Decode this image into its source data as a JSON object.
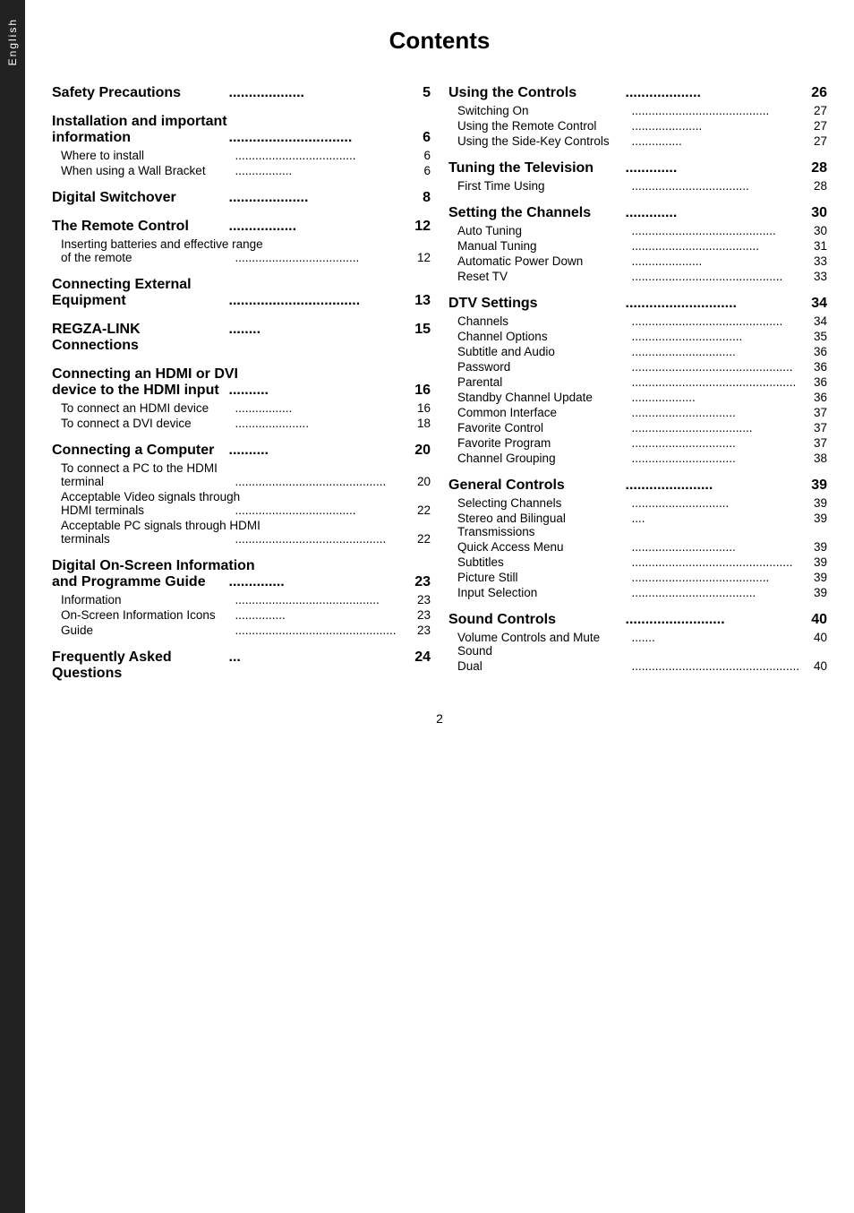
{
  "page": {
    "title": "Contents",
    "page_number": "2",
    "tab_label": "English"
  },
  "left_column": [
    {
      "type": "heading",
      "text": "Safety Precautions ",
      "dots": "...................",
      "page": "5"
    },
    {
      "type": "heading_multiline",
      "line1": "Installation and important",
      "line2": "information",
      "dots": "...............................",
      "page": "6"
    },
    {
      "type": "sub",
      "text": "Where to install",
      "dots": "....................................",
      "page": "6"
    },
    {
      "type": "sub",
      "text": "When using a Wall Bracket ",
      "dots": ".................",
      "page": "6"
    },
    {
      "type": "heading",
      "text": "Digital Switchover ",
      "dots": "....................",
      "page": "8"
    },
    {
      "type": "heading",
      "text": "The Remote Control ",
      "dots": ".................",
      "page": "12"
    },
    {
      "type": "sub_multiline",
      "line1": "Inserting batteries and effective range",
      "line2": "of the remote ",
      "dots": ".....................................",
      "page": "12"
    },
    {
      "type": "heading_multiline",
      "line1": "Connecting External",
      "line2": "Equipment",
      "dots": ".................................",
      "page": "13"
    },
    {
      "type": "heading",
      "text": "REGZA-LINK Connections",
      "dots": "........",
      "page": "15"
    },
    {
      "type": "heading_multiline",
      "line1": "Connecting an HDMI or DVI",
      "line2": "device to the HDMI input",
      "dots": "..........",
      "page": "16"
    },
    {
      "type": "sub",
      "text": "To connect an HDMI device ",
      "dots": ".................",
      "page": "16"
    },
    {
      "type": "sub",
      "text": "To connect a DVI device",
      "dots": "......................",
      "page": "18"
    },
    {
      "type": "heading",
      "text": "Connecting a Computer",
      "dots": "..........",
      "page": "20"
    },
    {
      "type": "sub_multiline",
      "line1": "To connect a PC to the HDMI",
      "line2": "terminal",
      "dots": ".............................................",
      "page": "20"
    },
    {
      "type": "sub_multiline",
      "line1": "Acceptable Video signals through",
      "line2": "HDMI terminals",
      "dots": "....................................",
      "page": "22"
    },
    {
      "type": "sub_multiline",
      "line1": "Acceptable PC signals through HDMI",
      "line2": "terminals",
      "dots": ".............................................",
      "page": "22"
    },
    {
      "type": "heading_multiline",
      "line1": "Digital On-Screen Information",
      "line2": "and Programme Guide",
      "dots": "..............",
      "page": "23"
    },
    {
      "type": "sub",
      "text": "Information ",
      "dots": "...........................................",
      "page": "23"
    },
    {
      "type": "sub",
      "text": "On-Screen Information Icons ",
      "dots": "...............",
      "page": "23"
    },
    {
      "type": "sub",
      "text": "Guide",
      "dots": "................................................",
      "page": "23"
    },
    {
      "type": "heading",
      "text": "Frequently Asked Questions",
      "dots": "...",
      "page": "24"
    }
  ],
  "right_column": [
    {
      "type": "heading",
      "text": "Using the Controls ",
      "dots": "...................",
      "page": "26"
    },
    {
      "type": "sub",
      "text": "Switching On ",
      "dots": ".........................................",
      "page": "27"
    },
    {
      "type": "sub",
      "text": "Using the Remote Control",
      "dots": ".....................",
      "page": "27"
    },
    {
      "type": "sub",
      "text": "Using the Side-Key Controls ",
      "dots": "...............",
      "page": "27"
    },
    {
      "type": "heading",
      "text": "Tuning the Television ",
      "dots": ".............",
      "page": "28"
    },
    {
      "type": "sub",
      "text": "First Time Using ",
      "dots": "...................................",
      "page": "28"
    },
    {
      "type": "heading",
      "text": "Setting the Channels",
      "dots": ".............",
      "page": "30"
    },
    {
      "type": "sub",
      "text": "Auto Tuning ",
      "dots": "...........................................",
      "page": "30"
    },
    {
      "type": "sub",
      "text": "Manual Tuning",
      "dots": "......................................",
      "page": "31"
    },
    {
      "type": "sub",
      "text": "Automatic Power Down ",
      "dots": ".....................",
      "page": "33"
    },
    {
      "type": "sub",
      "text": "Reset TV ",
      "dots": ".............................................",
      "page": "33"
    },
    {
      "type": "heading",
      "text": "DTV Settings ",
      "dots": "............................",
      "page": "34"
    },
    {
      "type": "sub",
      "text": "Channels ",
      "dots": ".............................................",
      "page": "34"
    },
    {
      "type": "sub",
      "text": "Channel Options",
      "dots": ".................................",
      "page": "35"
    },
    {
      "type": "sub",
      "text": "Subtitle and Audio ",
      "dots": "...............................",
      "page": "36"
    },
    {
      "type": "sub",
      "text": "Password",
      "dots": "................................................",
      "page": "36"
    },
    {
      "type": "sub",
      "text": "Parental",
      "dots": ".................................................",
      "page": "36"
    },
    {
      "type": "sub",
      "text": "Standby Channel Update ",
      "dots": "...................",
      "page": "36"
    },
    {
      "type": "sub",
      "text": "Common Interface",
      "dots": "...............................",
      "page": "37"
    },
    {
      "type": "sub",
      "text": "Favorite Control",
      "dots": "....................................",
      "page": "37"
    },
    {
      "type": "sub",
      "text": "Favorite Program",
      "dots": "...............................",
      "page": "37"
    },
    {
      "type": "sub",
      "text": "Channel Grouping ",
      "dots": "...............................",
      "page": "38"
    },
    {
      "type": "heading",
      "text": "General Controls ",
      "dots": "......................",
      "page": "39"
    },
    {
      "type": "sub",
      "text": "Selecting Channels ",
      "dots": ".............................",
      "page": "39"
    },
    {
      "type": "sub",
      "text": "Stereo and Bilingual Transmissions ",
      "dots": "....",
      "page": "39"
    },
    {
      "type": "sub",
      "text": "Quick Access Menu",
      "dots": "...............................",
      "page": "39"
    },
    {
      "type": "sub",
      "text": "Subtitles",
      "dots": "................................................",
      "page": "39"
    },
    {
      "type": "sub",
      "text": "Picture Still ",
      "dots": ".........................................",
      "page": "39"
    },
    {
      "type": "sub",
      "text": "Input Selection",
      "dots": ".....................................",
      "page": "39"
    },
    {
      "type": "heading",
      "text": "Sound Controls",
      "dots": ".........................",
      "page": "40"
    },
    {
      "type": "sub",
      "text": "Volume Controls and Mute Sound",
      "dots": ".......",
      "page": "40"
    },
    {
      "type": "sub",
      "text": "Dual",
      "dots": "..................................................",
      "page": "40"
    }
  ]
}
